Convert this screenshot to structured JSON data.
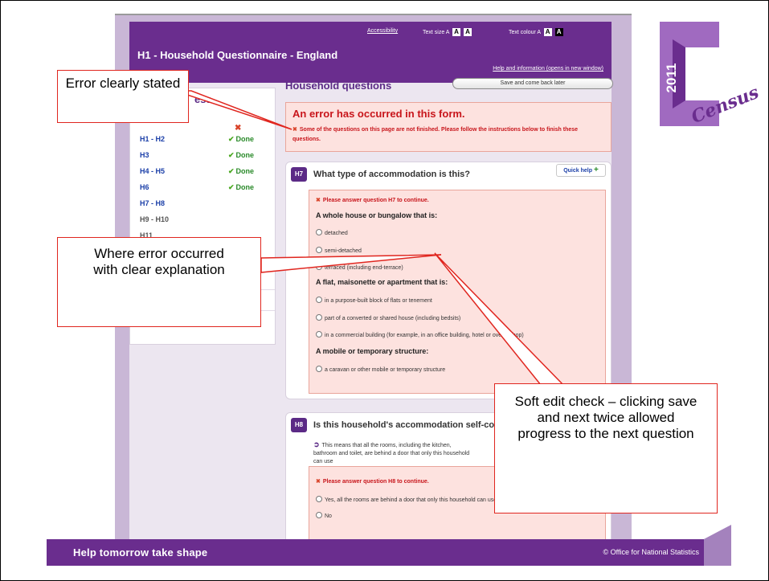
{
  "app": {
    "title": "H1 - Household Questionnaire - England",
    "utility": {
      "accessibility": "Accessibility",
      "text_size_label": "Text size",
      "text_size_a": "A",
      "text_colour_label": "Text colour",
      "text_colour_a": "A",
      "swatch_a": "A"
    },
    "help_link": "Help and information (opens in new window)"
  },
  "sidebar": {
    "title": "ess",
    "items": [
      {
        "label": "H1 - H2",
        "status": "Done"
      },
      {
        "label": "H3",
        "status": "Done"
      },
      {
        "label": "H4 - H5",
        "status": "Done"
      },
      {
        "label": "H6",
        "status": "Done"
      },
      {
        "label": "H7 - H8",
        "status": ""
      },
      {
        "label": "H9 - H10",
        "status": ""
      },
      {
        "label": "H11",
        "status": ""
      }
    ]
  },
  "main": {
    "title": "Household questions",
    "save_button": "Save and come back later",
    "error": {
      "title": "An error has occurred in this form.",
      "message": "Some of the questions on this page are not finished. Please follow the instructions below to finish these questions."
    },
    "questions": [
      {
        "number": "H7",
        "text": "What type of accommodation is this?",
        "quick_help": "Quick help",
        "error": "Please answer question H7 to continue.",
        "groups": [
          {
            "heading": "A whole house or bungalow that is:",
            "options": [
              "detached",
              "semi-detached",
              "terraced (including end-terrace)"
            ]
          },
          {
            "heading": "A flat, maisonette or apartment that is:",
            "options": [
              "in a purpose-built block of flats or tenement",
              "part of a converted or shared house (including bedsits)",
              "in a commercial building (for example, in an office building, hotel or over a shop)"
            ]
          },
          {
            "heading": "A mobile or temporary structure:",
            "options": [
              "a caravan or other mobile or temporary structure"
            ]
          }
        ]
      },
      {
        "number": "H8",
        "text": "Is this household's accommodation self-contained?",
        "note": "This means that all the rooms, including the kitchen, bathroom and toilet, are behind a door that only this household can use",
        "error": "Please answer question H8 to continue.",
        "options": [
          "Yes, all the rooms are behind a door that only this household can use",
          "No"
        ]
      }
    ]
  },
  "footer": {
    "tagline": "Help tomorrow take shape",
    "copyright": "© Office for National Statistics"
  },
  "logo": {
    "year": "2011",
    "letter": "C",
    "word": "Census"
  },
  "callouts": {
    "error_stated": "Error clearly stated",
    "where_error": "Where error occurred with clear explanation",
    "soft_edit": "Soft edit check – clicking save and next twice allowed progress to the next question"
  },
  "colors": {
    "brand_purple": "#6a2d8e",
    "error_red": "#c8151b",
    "error_bg": "#fde2df",
    "callout_border": "#e0261f",
    "done_green": "#2a8a2a"
  }
}
